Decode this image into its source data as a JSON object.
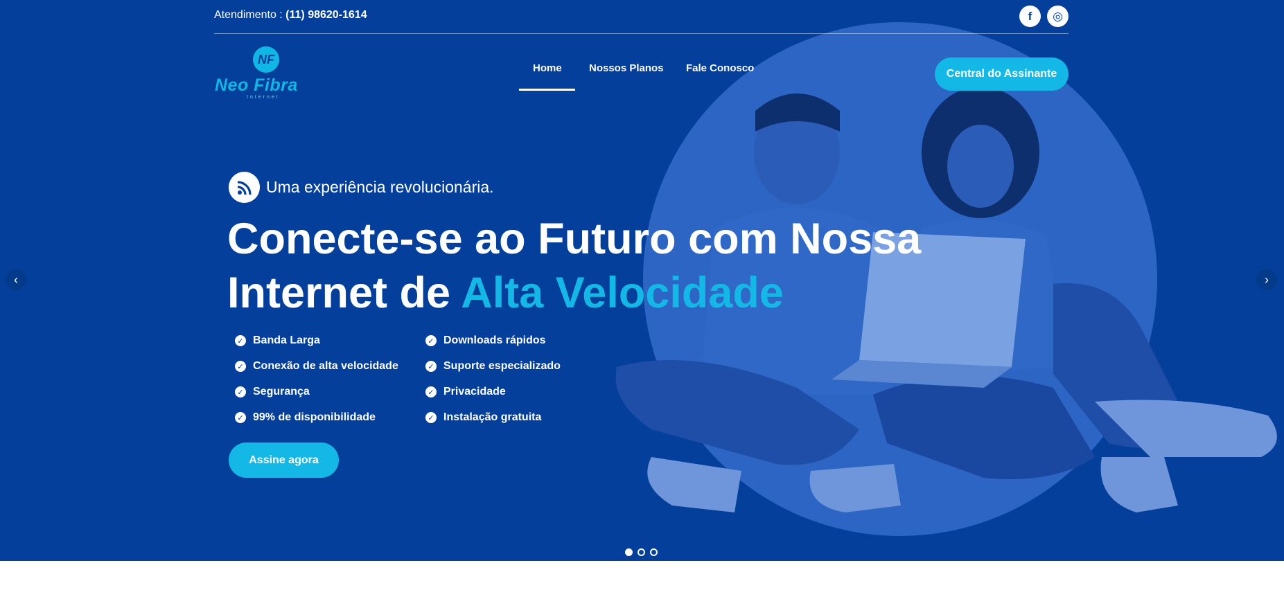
{
  "topbar": {
    "atendimento_label": "Atendimento : ",
    "phone": "(11) 98620-1614",
    "social": [
      {
        "name": "facebook-icon",
        "glyph": "f"
      },
      {
        "name": "instagram-icon",
        "glyph": "◎"
      }
    ]
  },
  "logo": {
    "mark": "NF",
    "name": "Neo Fibra",
    "sub": "Internet"
  },
  "nav": {
    "items": [
      {
        "label": "Home",
        "active": true
      },
      {
        "label": "Nossos Planos",
        "active": false
      },
      {
        "label": "Fale Conosco",
        "active": false
      }
    ],
    "cta": "Central do Assinante"
  },
  "hero": {
    "tagline": "Uma experiência revolucionária.",
    "headline_line1": "Conecte-se ao Futuro com Nossa",
    "headline_line2_prefix": "Internet de ",
    "headline_line2_accent": "Alta Velocidade",
    "features": [
      "Banda Larga",
      "Conexão de alta velocidade",
      "Segurança",
      "99% de disponibilidade",
      "Downloads rápidos",
      "Suporte especializado",
      "Privacidade",
      "Instalação gratuita"
    ],
    "cta": "Assine agora"
  },
  "slider": {
    "prev": "‹",
    "next": "›",
    "slide_count": 3,
    "active_index": 0
  },
  "colors": {
    "background": "#04409b",
    "accent": "#14b8e6",
    "circle": "#3a6fd0"
  }
}
